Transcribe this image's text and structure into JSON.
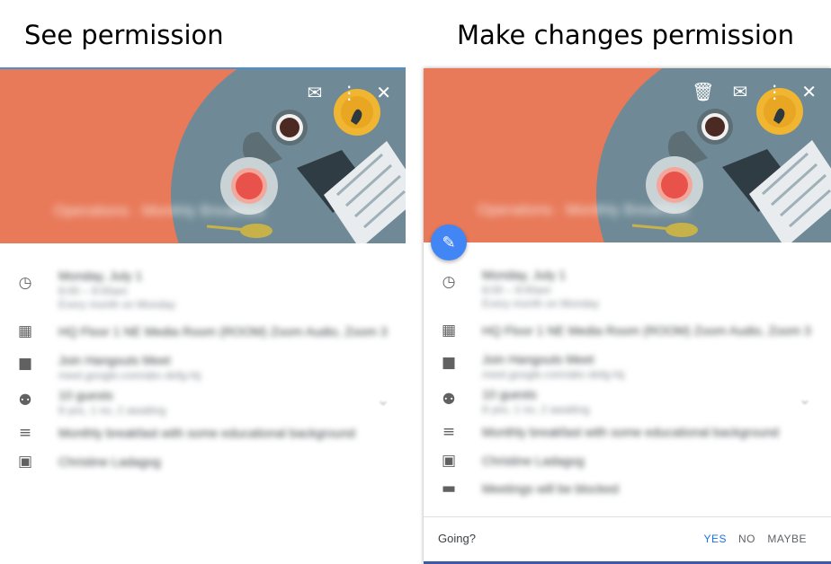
{
  "headings": {
    "left": "See permission",
    "right": "Make changes permission"
  },
  "icons": {
    "email": "email-icon",
    "more": "more-vert-icon",
    "close": "close-icon",
    "delete": "trash-icon",
    "edit": "pencil-icon",
    "time": "clock-icon",
    "location": "building-icon",
    "video": "video-camera-icon",
    "guests": "people-icon",
    "description": "notes-icon",
    "calendar": "calendar-icon",
    "briefcase": "briefcase-icon"
  },
  "blurred": {
    "event_title": "Operations · Monthly Breakfast",
    "date_line": "Monday, July 1",
    "time_line": "8:00 – 9:00am",
    "repeat_line": "Every month on Monday",
    "location": "HQ Floor 1 NE Media Room (ROOM) Zoom Audio, Zoom 3",
    "video_title": "Join Hangouts Meet",
    "video_sub": "meet.google.com/abc-defg-hij",
    "guests_title": "10 guests",
    "guests_sub": "8 yes, 1 no, 2 awaiting",
    "description": "Monthly breakfast with some educational background",
    "calendar": "Christine Ladagog",
    "busy": "Meetings will be blocked"
  },
  "footer": {
    "going_label": "Going?",
    "yes": "YES",
    "no": "NO",
    "maybe": "MAYBE"
  },
  "colors": {
    "hero": "#e87a5a",
    "accent": "#1a73e8",
    "fab": "#4285f4"
  }
}
